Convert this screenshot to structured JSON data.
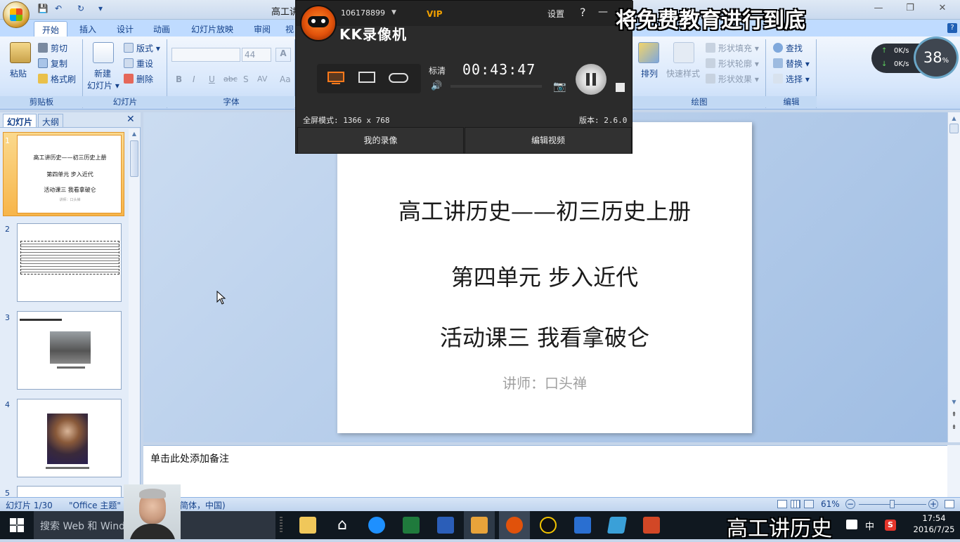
{
  "window": {
    "title": "高工讲"
  },
  "quick_access": {
    "save": "💾",
    "undo": "↶",
    "redo": "↻",
    "more": "▾"
  },
  "window_controls": {
    "minimize": "—",
    "restore": "❐",
    "close": "✕"
  },
  "ribbon_tabs": [
    "开始",
    "插入",
    "设计",
    "动画",
    "幻灯片放映",
    "审阅",
    "视"
  ],
  "ribbon": {
    "clipboard": {
      "paste": "粘贴",
      "cut": "剪切",
      "copy": "复制",
      "format_painter": "格式刷",
      "label": "剪贴板"
    },
    "slides": {
      "new_slide": "新建\n幻灯片",
      "new_slide_line1": "新建",
      "new_slide_line2": "幻灯片 ▾",
      "layout": "版式 ▾",
      "reset": "重设",
      "delete": "删除",
      "label": "幻灯片"
    },
    "font": {
      "size": "44",
      "label": "字体",
      "bold": "B",
      "italic": "I",
      "underline": "U",
      "strike": "abc",
      "shadow": "S",
      "spacing": "AV",
      "case": "Aa",
      "grow": "A"
    },
    "drawing": {
      "arrange": "排列",
      "quick_styles": "快速样式",
      "shape_fill": "形状填充 ▾",
      "shape_outline": "形状轮廓 ▾",
      "shape_effects": "形状效果 ▾",
      "label": "绘图"
    },
    "editing": {
      "find": "查找",
      "replace": "替换 ▾",
      "select": "选择 ▾",
      "label": "编辑"
    }
  },
  "left_pane": {
    "tab_slides": "幻灯片",
    "tab_outline": "大纲",
    "close": "✕"
  },
  "thumbnails": [
    {
      "num": "1",
      "lines": [
        "高工讲历史——初三历史上册",
        "第四单元 步入近代",
        "活动课三 我看拿破仑",
        "讲师：口头禅"
      ]
    },
    {
      "num": "2"
    },
    {
      "num": "3",
      "title": "人物介绍：拿破仑·波拿巴",
      "caption": "拿破仑时代的巴黎街景"
    },
    {
      "num": "4",
      "caption": "拿破仑画像（油画原作）"
    },
    {
      "num": "5"
    }
  ],
  "slide": {
    "title": "高工讲历史——初三历史上册",
    "unit": "第四单元  步入近代",
    "lesson": "活动课三 我看拿破仑",
    "lecturer": "讲师：口头禅"
  },
  "notes": {
    "placeholder": "单击此处添加备注"
  },
  "status": {
    "slide": "幻灯片 1/30",
    "theme": "\"Office 主题\"",
    "lang": "简体，中国)",
    "zoom": "61%",
    "zoom_level": 0.61
  },
  "kk": {
    "user": "106178899",
    "vip": "VIP",
    "settings": "设置",
    "help": "?",
    "minimize": "—",
    "brand": "KK录像机",
    "quality": "标清",
    "timer": "00:43:47",
    "mode": "全屏模式: 1366 x 768",
    "version": "版本: 2.6.0",
    "my_recordings": "我的录像",
    "edit_video": "编辑视频"
  },
  "network": {
    "up": "0K/s",
    "down": "0K/s",
    "percent": "38",
    "unit": "%"
  },
  "overlays": {
    "top": "将免费教育进行到底",
    "bottom": "高工讲历史"
  },
  "taskbar": {
    "search": "搜索 Web 和 Windows",
    "time": "17:54",
    "date": "2016/7/25",
    "ime": "中",
    "ime_s": "S"
  },
  "colors": {
    "ribbon": "#d6e6fb",
    "kk_accent": "#ff7a1a",
    "taskbar": "#101820"
  }
}
